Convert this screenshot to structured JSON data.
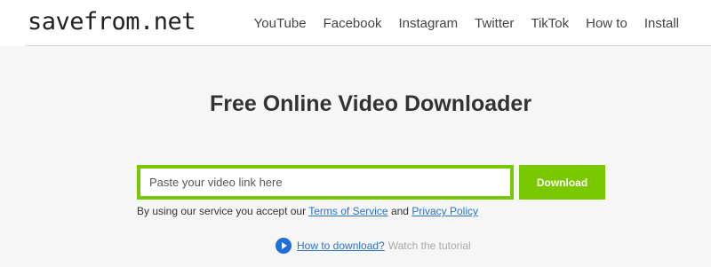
{
  "header": {
    "logo": "savefrom.net",
    "nav": [
      "YouTube",
      "Facebook",
      "Instagram",
      "Twitter",
      "TikTok",
      "How to",
      "Install"
    ]
  },
  "main": {
    "title": "Free Online Video Downloader",
    "input_placeholder": "Paste your video link here",
    "input_value": "",
    "download_label": "Download",
    "terms_prefix": "By using our service you accept our",
    "terms_link": "Terms of Service",
    "terms_and": "and",
    "privacy_link": "Privacy Policy",
    "howto_link": "How to download?",
    "howto_text": "Watch the tutorial",
    "play_icon": "play-circle-icon"
  },
  "colors": {
    "accent": "#7ac800",
    "link": "#2a73c7",
    "play_icon": "#1e6fd9",
    "background": "#f6f6f6"
  }
}
